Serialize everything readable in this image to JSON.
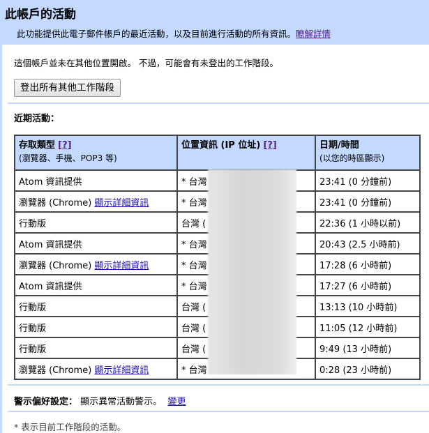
{
  "header": {
    "title": "此帳戶的活動",
    "description": "此功能提供此電子郵件帳戶的最近活動，以及目前進行活動的所有資訊。",
    "learn_more": "瞭解詳情"
  },
  "status_note": "這個帳戶並未在其他位置開啟。 不過，可能會有未登出的工作階段。",
  "signout_button": "登出所有其他工作階段",
  "recent_label": "近期活動：",
  "table": {
    "headers": [
      {
        "title": "存取類型",
        "help": "[?]",
        "sub": "(瀏覽器、手機、POP3 等)"
      },
      {
        "title": "位置資訊 (IP 位址)",
        "help": "[?]",
        "sub": ""
      },
      {
        "title": "日期/時間",
        "help": "",
        "sub": "(以您的時區顯示)"
      }
    ],
    "rows": [
      {
        "type": "Atom 資訊提供",
        "link": "",
        "location": "* 台灣",
        "time": "23:41 (0 分鐘前)"
      },
      {
        "type": "瀏覽器 (Chrome)",
        "link": "顯示詳細資訊",
        "location": "* 台灣",
        "time": "23:41 (0 分鐘前)"
      },
      {
        "type": "行動版",
        "link": "",
        "location": "台灣 (",
        "time": "22:36 (1 小時以前)"
      },
      {
        "type": "Atom 資訊提供",
        "link": "",
        "location": "* 台灣",
        "time": "20:43 (2.5 小時前)"
      },
      {
        "type": "瀏覽器 (Chrome)",
        "link": "顯示詳細資訊",
        "location": "* 台灣",
        "time": "17:28 (6 小時前)"
      },
      {
        "type": "Atom 資訊提供",
        "link": "",
        "location": "* 台灣",
        "time": "17:27 (6 小時前)"
      },
      {
        "type": "行動版",
        "link": "",
        "location": "台灣 (",
        "time": "13:13 (10 小時前)"
      },
      {
        "type": "行動版",
        "link": "",
        "location": "台灣 (",
        "time": "11:05 (12 小時前)"
      },
      {
        "type": "行動版",
        "link": "",
        "location": "台灣 (",
        "time": "9:49 (13 小時前)"
      },
      {
        "type": "瀏覽器 (Chrome)",
        "link": "顯示詳細資訊",
        "location": "* 台灣",
        "time": "0:28 (23 小時前)"
      }
    ]
  },
  "alert_pref": {
    "label": "警示偏好設定：",
    "value": "顯示異常活動警示。",
    "change": "變更"
  },
  "footnote": "* 表示目前工作階段的活動。"
}
